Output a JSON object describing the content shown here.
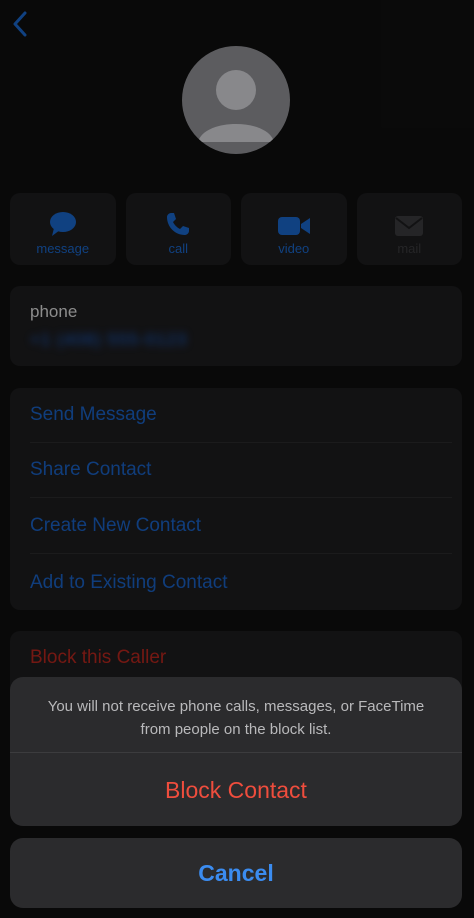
{
  "colors": {
    "accent": "#1a64c6",
    "destructive": "#ef4d3d",
    "cancel": "#3b8cf0",
    "card": "#1c1c1e",
    "sheet": "#2b2b2d"
  },
  "nav": {
    "back_icon": "chevron-left-icon"
  },
  "avatar": {
    "icon": "person-silhouette-icon"
  },
  "actions": [
    {
      "label": "message",
      "icon": "message-bubble-icon",
      "enabled": true
    },
    {
      "label": "call",
      "icon": "phone-icon",
      "enabled": true
    },
    {
      "label": "video",
      "icon": "video-camera-icon",
      "enabled": true
    },
    {
      "label": "mail",
      "icon": "envelope-icon",
      "enabled": false
    }
  ],
  "phone": {
    "label": "phone",
    "number": "+1 (408) 555-0123"
  },
  "options": [
    {
      "label": "Send Message"
    },
    {
      "label": "Share Contact"
    },
    {
      "label": "Create New Contact"
    },
    {
      "label": "Add to Existing Contact"
    }
  ],
  "block": {
    "caller_label": "Block this Caller"
  },
  "sheet": {
    "message": "You will not receive phone calls, messages, or FaceTime from people on the block list.",
    "confirm_label": "Block Contact",
    "cancel_label": "Cancel"
  }
}
